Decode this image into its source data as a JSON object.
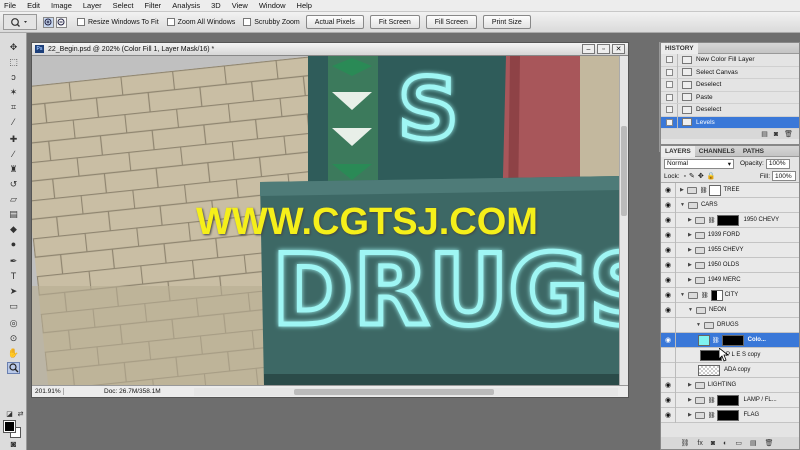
{
  "menubar": [
    "File",
    "Edit",
    "Image",
    "Layer",
    "Select",
    "Filter",
    "Analysis",
    "3D",
    "View",
    "Window",
    "Help"
  ],
  "options": {
    "resize_windows": "Resize Windows To Fit",
    "zoom_all": "Zoom All Windows",
    "scrubby_zoom": "Scrubby Zoom",
    "actual_pixels": "Actual Pixels",
    "fit_screen": "Fit Screen",
    "fill_screen": "Fill Screen",
    "print_size": "Print Size"
  },
  "document": {
    "title": "22_Begin.psd @ 202% (Color Fill 1, Layer Mask/16) *",
    "zoom": "201.91%",
    "doc_size": "Doc: 26.7M/358.1M"
  },
  "canvas": {
    "sign_letter_top": "S",
    "sign_word": "DRUGS"
  },
  "watermark": "WWW.CGTSJ.COM",
  "history": {
    "tab": "HISTORY",
    "items": [
      "New Color Fill Layer",
      "Select Canvas",
      "Deselect",
      "Paste",
      "Deselect",
      "Levels"
    ]
  },
  "layers": {
    "tabs": [
      "LAYERS",
      "CHANNELS",
      "PATHS"
    ],
    "blend_mode": "Normal",
    "opacity_label": "Opacity:",
    "opacity_value": "100%",
    "lock_label": "Lock:",
    "fill_label": "Fill:",
    "fill_value": "100%",
    "rows": [
      {
        "name": "TREE"
      },
      {
        "name": "CARS"
      },
      {
        "name": "1950 CHEVY"
      },
      {
        "name": "1939 FORD"
      },
      {
        "name": "1955 CHEVY"
      },
      {
        "name": "1950 OLDS"
      },
      {
        "name": "1949 MERC"
      },
      {
        "name": "CITY"
      },
      {
        "name": "NEON"
      },
      {
        "name": "DRUGS"
      },
      {
        "name": "Colo..."
      },
      {
        "name": "P L E S copy"
      },
      {
        "name": "ADA copy"
      },
      {
        "name": "LIGHTING"
      },
      {
        "name": "LAMP / FL..."
      },
      {
        "name": "FLAG"
      }
    ]
  },
  "colors": {
    "neon": "#7ff3f0",
    "watermark": "#f5ef1a",
    "selection": "#3a78d8"
  }
}
